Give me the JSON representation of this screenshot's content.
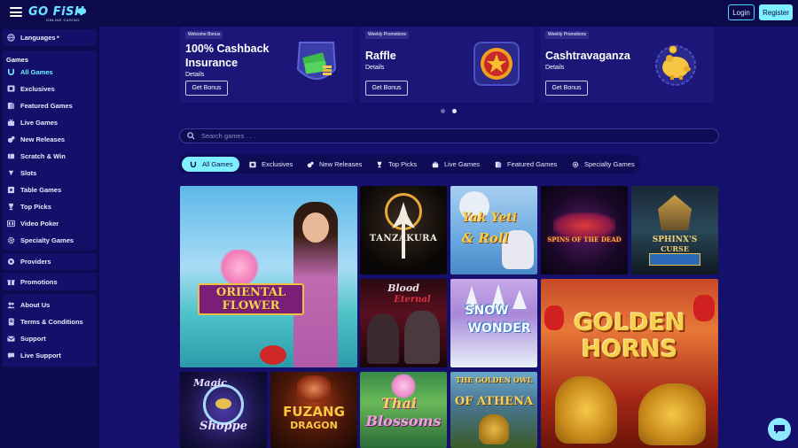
{
  "header": {
    "logo": "GO FiSH",
    "logo_sub": "ONLINE CASINO",
    "login_label": "Login",
    "register_label": "Register"
  },
  "sidebar": {
    "languages_label": "Languages",
    "games_heading": "Games",
    "game_items": [
      {
        "label": "All Games",
        "icon": "horseshoe-icon",
        "active": true
      },
      {
        "label": "Exclusives",
        "icon": "film-icon"
      },
      {
        "label": "Featured Games",
        "icon": "cards-icon"
      },
      {
        "label": "Live Games",
        "icon": "live-icon"
      },
      {
        "label": "New Releases",
        "icon": "sparkle-icon"
      },
      {
        "label": "Scratch & Win",
        "icon": "ticket-icon"
      },
      {
        "label": "Slots",
        "icon": "slot-icon"
      },
      {
        "label": "Table Games",
        "icon": "table-icon"
      },
      {
        "label": "Top Picks",
        "icon": "trophy-icon"
      },
      {
        "label": "Video Poker",
        "icon": "poker-icon"
      },
      {
        "label": "Specialty Games",
        "icon": "gear-icon"
      }
    ],
    "providers_label": "Providers",
    "promotions_label": "Promotions",
    "info_items": [
      {
        "label": "About Us",
        "icon": "people-icon"
      },
      {
        "label": "Terms & Conditions",
        "icon": "document-icon"
      },
      {
        "label": "Support",
        "icon": "mail-icon"
      },
      {
        "label": "Live Support",
        "icon": "chat-icon"
      }
    ]
  },
  "promos": [
    {
      "badge": "Welcome Bonus",
      "title_line1": "100% Cashback",
      "title_line2": "Insurance",
      "details": "Details",
      "button": "Get Bonus",
      "icon": "cash-stack-icon"
    },
    {
      "badge": "Weekly Promotions",
      "title_line1": "Raffle",
      "title_line2": "",
      "details": "Details",
      "button": "Get Bonus",
      "icon": "star-coin-icon"
    },
    {
      "badge": "Weekly Promotions",
      "title_line1": "Cashtravaganza",
      "title_line2": "",
      "details": "Details",
      "button": "Get Bonus",
      "icon": "piggy-bank-icon"
    }
  ],
  "carousel": {
    "pages": 2,
    "active": 2
  },
  "search": {
    "placeholder": "Search games . . ."
  },
  "tabs": [
    {
      "label": "All Games",
      "icon": "horseshoe-icon",
      "active": true
    },
    {
      "label": "Exclusives",
      "icon": "film-icon"
    },
    {
      "label": "New Releases",
      "icon": "sparkle-icon"
    },
    {
      "label": "Top Picks",
      "icon": "trophy-icon"
    },
    {
      "label": "Live Games",
      "icon": "live-icon"
    },
    {
      "label": "Featured Games",
      "icon": "cards-icon"
    },
    {
      "label": "Specialty Games",
      "icon": "gear-icon"
    }
  ],
  "games": [
    {
      "title_line1": "ORIENTAL",
      "title_line2": "FLOWER"
    },
    {
      "title_line1": "TANZAKURA",
      "title_line2": ""
    },
    {
      "title_line1": "Yak Yeti",
      "title_line2": "& Roll"
    },
    {
      "title_line1": "SPINS OF THE DEAD",
      "title_line2": ""
    },
    {
      "title_line1": "SPHINX'S",
      "title_line2": "CURSE"
    },
    {
      "title_line1": "Blood",
      "title_line2": "Eternal"
    },
    {
      "title_line1": "SNOW",
      "title_line2": "WONDER"
    },
    {
      "title_line1": "GOLDEN",
      "title_line2": "HORNS"
    },
    {
      "title_line1": "Magic",
      "title_line2": "Shoppe"
    },
    {
      "title_line1": "FUZANG",
      "title_line2": "DRAGON"
    },
    {
      "title_line1": "Thai",
      "title_line2": "Blossoms"
    },
    {
      "title_line1": "THE GOLDEN OWL",
      "title_line2": "OF ATHENA"
    }
  ]
}
